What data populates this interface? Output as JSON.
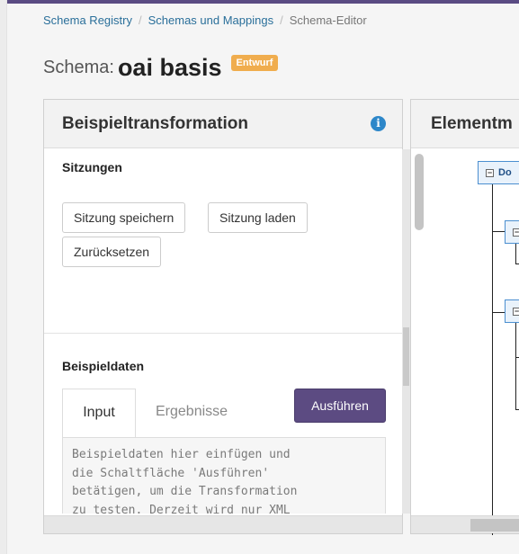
{
  "breadcrumb": {
    "item1": "Schema Registry",
    "item2": "Schemas und Mappings",
    "current": "Schema-Editor",
    "separator": "/"
  },
  "page": {
    "label": "Schema:",
    "name": "oai basis",
    "status_badge": "Entwurf",
    "badge_color": "#f0ad4e"
  },
  "transform_panel": {
    "title": "Beispieltransformation",
    "info_icon": "info-icon",
    "sessions": {
      "title": "Sitzungen",
      "save_label": "Sitzung speichern",
      "load_label": "Sitzung laden",
      "reset_label": "Zurücksetzen"
    },
    "sample": {
      "title": "Beispieldaten",
      "tab_input": "Input",
      "tab_results": "Ergebnisse",
      "run_label": "Ausführen",
      "run_color": "#5c4b82",
      "placeholder": "Beispieldaten hier einfügen und\ndie Schaltfläche 'Ausführen'\nbetätigen, um die Transformation\nzu testen. Derzeit wird nur XML\nals Eingangsformat interpretiert."
    }
  },
  "element_panel": {
    "title": "Elementm",
    "root_node": "Do"
  }
}
